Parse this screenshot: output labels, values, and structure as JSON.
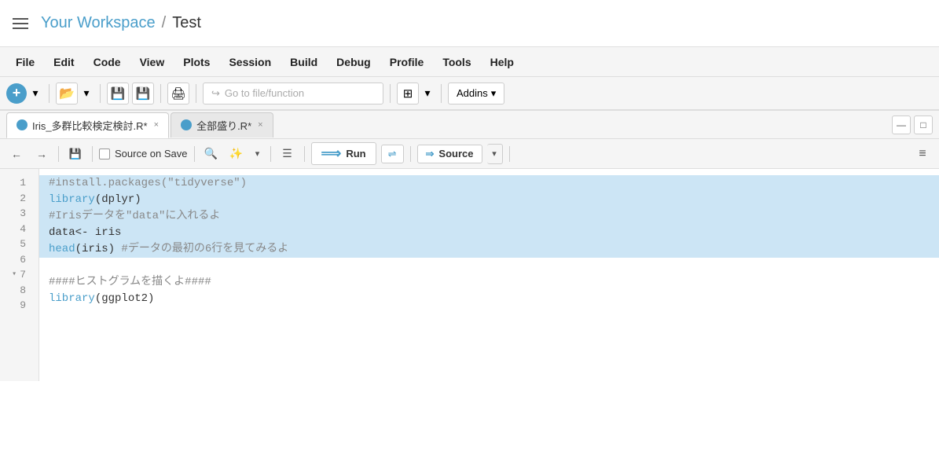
{
  "topbar": {
    "workspace": "Your Workspace",
    "separator": "/",
    "project": "Test"
  },
  "menubar": {
    "items": [
      "File",
      "Edit",
      "Code",
      "View",
      "Plots",
      "Session",
      "Build",
      "Debug",
      "Profile",
      "Tools",
      "Help"
    ]
  },
  "toolbar": {
    "go_to_file_placeholder": "Go to file/function",
    "addins_label": "Addins"
  },
  "tabs": {
    "tab1_label": "Iris_多群比較検定検討.R*",
    "tab2_label": "全部盛り.R*",
    "close_label": "×"
  },
  "editor_toolbar": {
    "source_on_save": "Source on Save",
    "run_label": "Run",
    "source_label": "Source"
  },
  "code": {
    "lines": [
      {
        "num": 1,
        "content": "#install.packages(\"tidyverse\")",
        "type": "comment",
        "highlighted": true,
        "fold": false
      },
      {
        "num": 2,
        "content": "library(dplyr)",
        "type": "code",
        "highlighted": true,
        "fold": false
      },
      {
        "num": 3,
        "content": "#Irisデータを\"data\"に入れるよ",
        "type": "comment",
        "highlighted": true,
        "fold": false
      },
      {
        "num": 4,
        "content": "data<- iris",
        "type": "code",
        "highlighted": true,
        "fold": false
      },
      {
        "num": 5,
        "content": "head(iris) #データの最初の6行を見てみるよ",
        "type": "code",
        "highlighted": true,
        "fold": false
      },
      {
        "num": 6,
        "content": "",
        "type": "empty",
        "highlighted": false,
        "fold": false
      },
      {
        "num": 7,
        "content": "####ヒストグラムを描くよ####",
        "type": "comment",
        "highlighted": false,
        "fold": true
      },
      {
        "num": 8,
        "content": "library(ggplot2)",
        "type": "code",
        "highlighted": false,
        "fold": false
      },
      {
        "num": 9,
        "content": "",
        "type": "partial",
        "highlighted": false,
        "fold": false
      }
    ]
  },
  "icons": {
    "hamburger": "≡",
    "new_file": "●",
    "open": "📂",
    "save": "💾",
    "save_all": "💾",
    "print": "🖨",
    "go_arrow": "↪",
    "grid": "⊞",
    "chevron_down": "▾",
    "back": "←",
    "forward": "→",
    "save_doc": "💾",
    "search": "🔍",
    "magic": "✨",
    "list": "☰",
    "run_arrow": "⟹",
    "re_run": "⇌",
    "source_arrow": "⇒",
    "align": "≡",
    "minimize": "—",
    "maximize": "□"
  }
}
